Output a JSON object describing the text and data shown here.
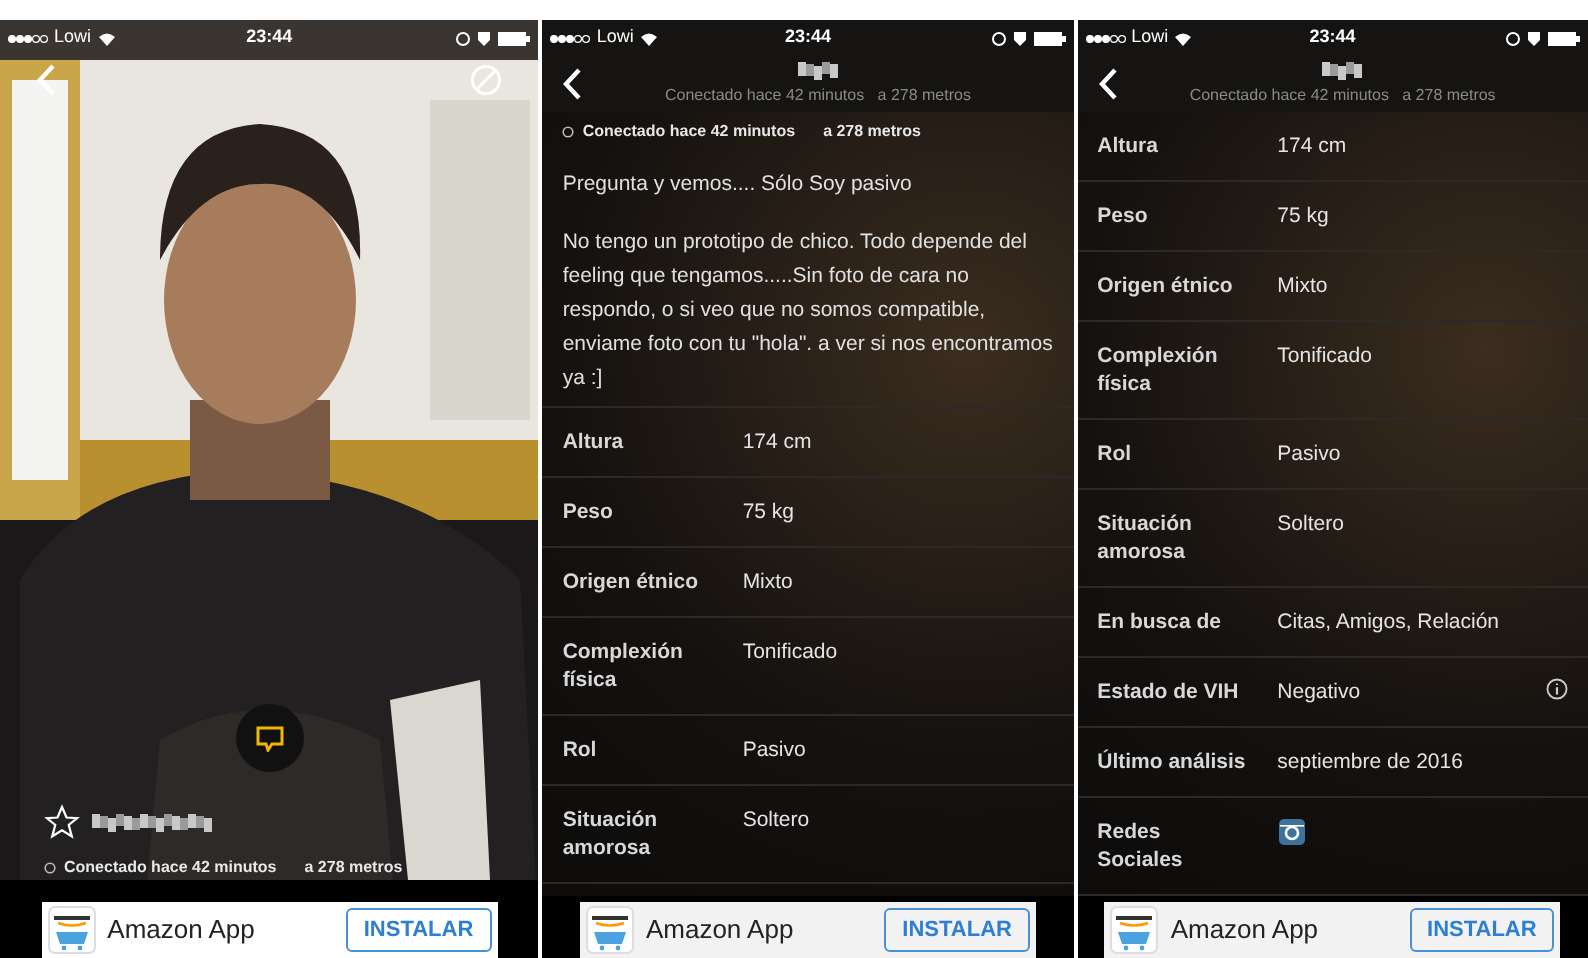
{
  "panels": [
    {
      "status_bar": {
        "carrier": "Lowi",
        "time": "23:44"
      },
      "online": "Conectado hace 42 minutos",
      "distance": "a 278 metros",
      "ad": {
        "title": "Amazon App",
        "button": "INSTALAR"
      }
    },
    {
      "kind": "details",
      "status_bar": {
        "carrier": "Lowi",
        "time": "23:44"
      },
      "header_subtitle": "Conectado hace 42 minutos   a 278 metros",
      "online": "Conectado hace 42 minutos",
      "distance": "a 278 metros",
      "bio": [
        "Pregunta y vemos.... Sólo Soy pasivo",
        "No tengo un prototipo de chico. Todo depende del feeling que tengamos.....Sin foto de cara no respondo, o si veo que no somos compatible, enviame foto con tu \"hola\". a ver si nos encontramos ya :]"
      ],
      "rows": [
        {
          "kind": "text",
          "label": "Altura",
          "value": "174 cm"
        },
        {
          "kind": "text",
          "label": "Peso",
          "value": "75 kg"
        },
        {
          "kind": "text",
          "label": "Origen étnico",
          "value": "Mixto"
        },
        {
          "kind": "text",
          "label": "Complexión física",
          "value": "Tonificado"
        },
        {
          "kind": "text",
          "label": "Rol",
          "value": "Pasivo"
        },
        {
          "kind": "text",
          "label": "Situación amorosa",
          "value": "Soltero"
        }
      ],
      "ad": {
        "title": "Amazon App",
        "button": "INSTALAR"
      }
    },
    {
      "kind": "details",
      "status_bar": {
        "carrier": "Lowi",
        "time": "23:44"
      },
      "header_subtitle": "Conectado hace 42 minutos   a 278 metros",
      "rows": [
        {
          "kind": "text",
          "label": "Altura",
          "value": "174 cm"
        },
        {
          "kind": "text",
          "label": "Peso",
          "value": "75 kg"
        },
        {
          "kind": "text",
          "label": "Origen étnico",
          "value": "Mixto"
        },
        {
          "kind": "text",
          "label": "Complexión física",
          "value": "Tonificado"
        },
        {
          "kind": "text",
          "label": "Rol",
          "value": "Pasivo"
        },
        {
          "kind": "text",
          "label": "Situación amorosa",
          "value": "Soltero"
        },
        {
          "kind": "text",
          "label": "En busca de",
          "value": "Citas, Amigos, Relación"
        },
        {
          "kind": "info",
          "label": "Estado de VIH",
          "value": "Negativo"
        },
        {
          "kind": "text",
          "label": "Último análisis",
          "value": "septiembre de 2016"
        },
        {
          "kind": "social",
          "label": "Redes Sociales"
        }
      ],
      "ad": {
        "title": "Amazon App",
        "button": "INSTALAR"
      }
    }
  ]
}
